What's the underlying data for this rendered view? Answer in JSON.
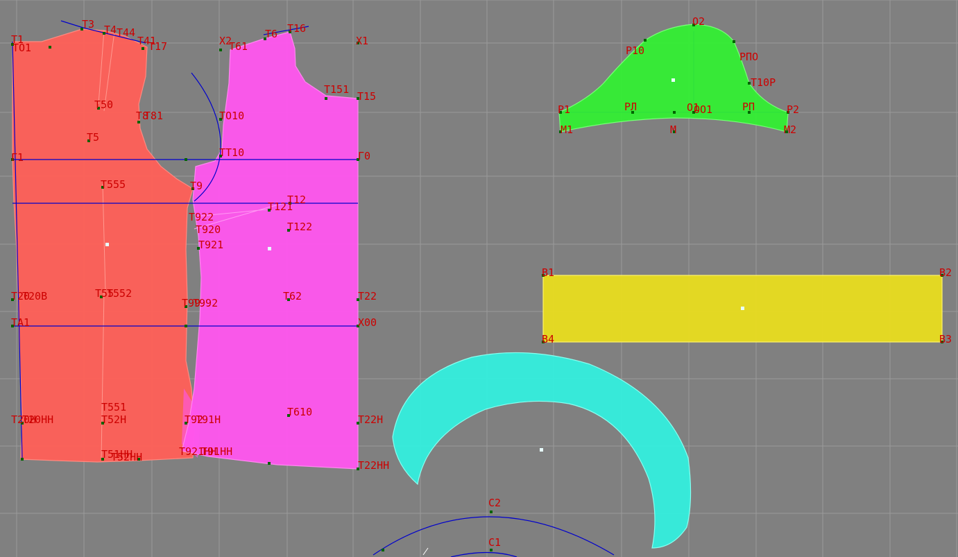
{
  "colors": {
    "background": "#808080",
    "grid": "#9a9a9a",
    "label": "#cc0000",
    "node": "#006400",
    "line": "#0000cc",
    "front_fill": "#ff5f57",
    "back_fill": "#ff55ee",
    "sleeve_fill": "#33ee33",
    "band_fill": "#e8dc1e",
    "collar_fill": "#33eedd"
  },
  "pieces": [
    {
      "id": "front-piece",
      "name_icon": "front-bodice-piece"
    },
    {
      "id": "back-piece",
      "name_icon": "back-bodice-piece"
    },
    {
      "id": "sleeve-piece",
      "name_icon": "sleeve-cap-piece"
    },
    {
      "id": "band-piece",
      "name_icon": "rectangular-band-piece"
    },
    {
      "id": "collar-piece",
      "name_icon": "crescent-collar-piece"
    }
  ],
  "labels": {
    "front": [
      "T1",
      "TO1",
      "T3",
      "T4",
      "T44",
      "T41",
      "T17",
      "T50",
      "T8",
      "T81",
      "T5",
      "Г1",
      "T555",
      "T20",
      "T20B",
      "T55",
      "T552",
      "TA1",
      "T20H",
      "T20HH",
      "T551",
      "T52H",
      "T51HH",
      "T52HH"
    ],
    "back": [
      "X2",
      "T61",
      "X1",
      "T6",
      "T16",
      "T151",
      "T15",
      "TO10",
      "TT10",
      "Г0",
      "T12",
      "T121",
      "T122",
      "T9",
      "T922",
      "T920",
      "T921",
      "T99",
      "T992",
      "T62",
      "T22",
      "X00",
      "T610",
      "T22H",
      "T92",
      "T91H",
      "T921HH",
      "T91HH",
      "T22HH"
    ],
    "sleeve": [
      "O2",
      "P10",
      "PПO",
      "T10P",
      "P1",
      "PЛ",
      "O1",
      "OO1",
      "PП",
      "P2",
      "M1",
      "M",
      "M2"
    ],
    "band": [
      "B1",
      "B2",
      "B4",
      "B3"
    ],
    "collar": [
      "C2",
      "C1"
    ]
  }
}
